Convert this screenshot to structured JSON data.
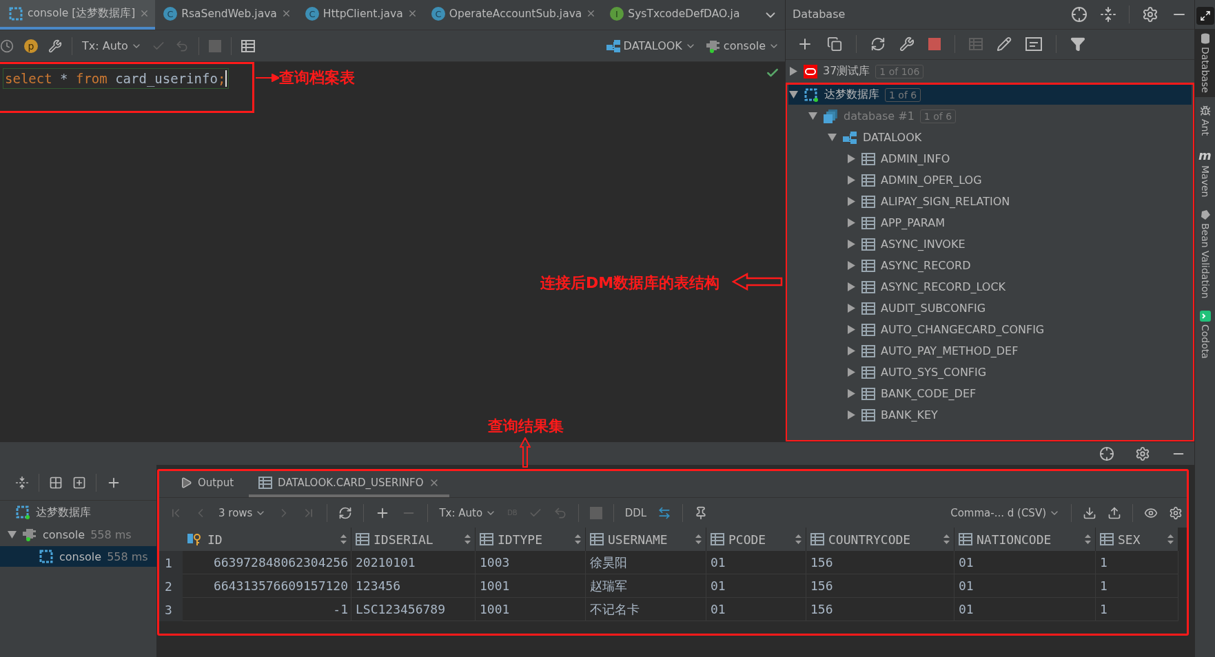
{
  "editor_tabs": [
    {
      "label": "console [达梦数据库]",
      "kind": "console",
      "selected": true,
      "closable": true
    },
    {
      "label": "RsaSendWeb.java",
      "kind": "class",
      "letter": "C",
      "selected": false,
      "closable": true
    },
    {
      "label": "HttpClient.java",
      "kind": "class",
      "letter": "C",
      "selected": false,
      "closable": true
    },
    {
      "label": "OperateAccountSub.java",
      "kind": "class",
      "letter": "C",
      "selected": false,
      "closable": true
    },
    {
      "label": "SysTxcodeDefDAO.ja",
      "kind": "interface",
      "letter": "I",
      "selected": false,
      "closable": false
    }
  ],
  "p_letter": "p",
  "editor_toolbar": {
    "tx": "Tx: Auto",
    "datasource": "DATALOOK",
    "session": "console"
  },
  "editor": {
    "tokens": [
      {
        "kind": "keyword",
        "text": "select"
      },
      {
        "kind": "plain",
        "text": " * "
      },
      {
        "kind": "keyword",
        "text": "from"
      },
      {
        "kind": "plain",
        "text": " card_userinfo"
      },
      {
        "kind": "punct",
        "text": ";"
      }
    ]
  },
  "annotations": [
    {
      "kind": "left",
      "text": "查询档案表"
    },
    {
      "kind": "right",
      "text": "连接后DM数据库的表结构"
    },
    {
      "kind": "up",
      "text": "查询结果集"
    }
  ],
  "database_panel": {
    "title": "Database",
    "tree": [
      {
        "label": "37测试库",
        "badge": "1 of 106",
        "kind": "oracle",
        "expanded": false,
        "selected": false
      },
      {
        "label": "达梦数据库",
        "badge": "1 of 6",
        "kind": "dm",
        "expanded": true,
        "selected": true,
        "children": [
          {
            "label": "database #1",
            "badge": "1 of 6",
            "kind": "database",
            "expanded": true,
            "selected": false,
            "children": [
              {
                "label": "DATALOOK",
                "kind": "schema",
                "expanded": true,
                "selected": false,
                "children": [
                  {
                    "label": "ADMIN_INFO",
                    "kind": "table",
                    "expanded": false,
                    "selected": false
                  },
                  {
                    "label": "ADMIN_OPER_LOG",
                    "kind": "table",
                    "expanded": false,
                    "selected": false
                  },
                  {
                    "label": "ALIPAY_SIGN_RELATION",
                    "kind": "table",
                    "expanded": false,
                    "selected": false
                  },
                  {
                    "label": "APP_PARAM",
                    "kind": "table",
                    "expanded": false,
                    "selected": false
                  },
                  {
                    "label": "ASYNC_INVOKE",
                    "kind": "table",
                    "expanded": false,
                    "selected": false
                  },
                  {
                    "label": "ASYNC_RECORD",
                    "kind": "table",
                    "expanded": false,
                    "selected": false
                  },
                  {
                    "label": "ASYNC_RECORD_LOCK",
                    "kind": "table",
                    "expanded": false,
                    "selected": false
                  },
                  {
                    "label": "AUDIT_SUBCONFIG",
                    "kind": "table",
                    "expanded": false,
                    "selected": false
                  },
                  {
                    "label": "AUTO_CHANGECARD_CONFIG",
                    "kind": "table",
                    "expanded": false,
                    "selected": false
                  },
                  {
                    "label": "AUTO_PAY_METHOD_DEF",
                    "kind": "table",
                    "expanded": false,
                    "selected": false
                  },
                  {
                    "label": "AUTO_SYS_CONFIG",
                    "kind": "table",
                    "expanded": false,
                    "selected": false
                  },
                  {
                    "label": "BANK_CODE_DEF",
                    "kind": "table",
                    "expanded": false,
                    "selected": false
                  },
                  {
                    "label": "BANK_KEY",
                    "kind": "table",
                    "expanded": false,
                    "selected": false
                  }
                ]
              }
            ]
          }
        ]
      }
    ]
  },
  "side_stripe": [
    {
      "label": "Database",
      "kind": "database",
      "selected": true
    },
    {
      "label": "Ant",
      "kind": "ant",
      "selected": false
    },
    {
      "label": "Maven",
      "kind": "maven",
      "letter": "m",
      "selected": false
    },
    {
      "label": "Bean Validation",
      "kind": "bean",
      "selected": false
    },
    {
      "label": "Codota",
      "kind": "codota",
      "selected": false
    }
  ],
  "services": {
    "tree": [
      {
        "label": "达梦数据库",
        "kind": "dm",
        "selected": false,
        "children": [
          {
            "label": "console",
            "time": "558 ms",
            "kind": "session",
            "expanded": true,
            "selected": false,
            "children": [
              {
                "label": "console",
                "time": "558 ms",
                "kind": "console",
                "selected": true
              }
            ]
          }
        ]
      }
    ]
  },
  "results": {
    "tabs": [
      {
        "label": "Output",
        "kind": "output",
        "selected": false,
        "closable": false
      },
      {
        "label": "DATALOOK.CARD_USERINFO",
        "kind": "table",
        "selected": true,
        "closable": true
      }
    ],
    "rows_label": "3 rows",
    "tx": "Tx: Auto",
    "db_label": "DB",
    "ddl": "DDL",
    "format": "Comma-... d (CSV)",
    "columns": [
      {
        "name": "ID",
        "kind": "key"
      },
      {
        "name": "IDSERIAL",
        "kind": "column"
      },
      {
        "name": "IDTYPE",
        "kind": "column"
      },
      {
        "name": "USERNAME",
        "kind": "column"
      },
      {
        "name": "PCODE",
        "kind": "column"
      },
      {
        "name": "COUNTRYCODE",
        "kind": "column"
      },
      {
        "name": "NATIONCODE",
        "kind": "column"
      },
      {
        "name": "SEX",
        "kind": "column"
      }
    ],
    "rows": [
      {
        "num": "1",
        "cells": [
          "663972848062304256",
          "20210101",
          "1003",
          "徐昊阳",
          "01",
          "156",
          "01",
          "1"
        ]
      },
      {
        "num": "2",
        "cells": [
          "664313576609157120",
          "123456",
          "1001",
          "赵瑞军",
          "01",
          "156",
          "01",
          "1"
        ]
      },
      {
        "num": "3",
        "cells": [
          "-1",
          "LSC123456789",
          "1001",
          "不记名卡",
          "01",
          "156",
          "01",
          "1"
        ]
      }
    ]
  }
}
